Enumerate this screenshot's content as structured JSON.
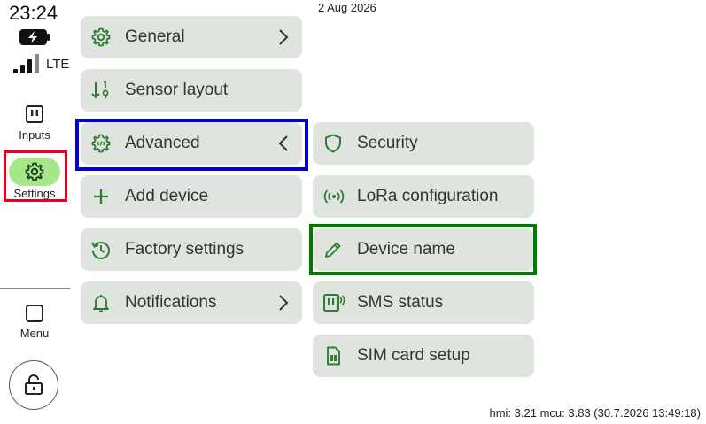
{
  "status": {
    "time": "23:24",
    "network": "LTE",
    "date": "2 Aug 2026",
    "version": "hmi: 3.21 mcu: 3.83 (30.7.2026 13:49:18)"
  },
  "rail": {
    "inputs_label": "Inputs",
    "settings_label": "Settings",
    "menu_label": "Menu"
  },
  "menu": {
    "general": "General",
    "sensor_layout": "Sensor layout",
    "advanced": "Advanced",
    "add_device": "Add device",
    "factory_settings": "Factory settings",
    "notifications": "Notifications"
  },
  "submenu": {
    "security": "Security",
    "lora": "LoRa configuration",
    "device_name": "Device name",
    "sms_status": "SMS status",
    "sim_setup": "SIM card setup"
  },
  "colors": {
    "icon_green": "#2e7d32",
    "active_pill": "#a6e78b",
    "button_bg": "#dfe4df",
    "highlight_red": "#e8001c",
    "highlight_blue": "#0000d8",
    "highlight_green": "#007a00"
  }
}
